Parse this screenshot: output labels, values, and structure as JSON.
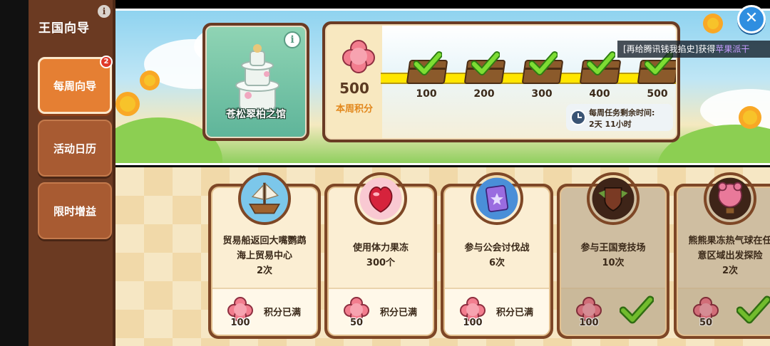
{
  "sidebar": {
    "title": "王国向导",
    "items": [
      {
        "label": "每周向导",
        "badge": "2"
      },
      {
        "label": "活动日历"
      },
      {
        "label": "限时增益"
      }
    ]
  },
  "building": {
    "name": "苍松翠柏之馆"
  },
  "weekly": {
    "points": "500",
    "points_label": "本周积分",
    "milestones": [
      "100",
      "200",
      "300",
      "400",
      "500"
    ],
    "timer_title": "每周任务剩余时间:",
    "timer_value": "2天 11小时"
  },
  "notice": {
    "prefix": "[再给腾讯钱我掐史]获得",
    "highlight": "苹果派干"
  },
  "tasks": [
    {
      "line1": "贸易船返回大嘴鹦鹉",
      "line2": "海上贸易中心",
      "count": "2次",
      "points": "100",
      "status": "积分已满"
    },
    {
      "line1": "使用体力果冻",
      "line2": "",
      "count": "300个",
      "points": "50",
      "status": "积分已满"
    },
    {
      "line1": "参与公会讨伐战",
      "line2": "",
      "count": "6次",
      "points": "100",
      "status": "积分已满"
    },
    {
      "line1": "参与王国竞技场",
      "line2": "",
      "count": "10次",
      "points": "100",
      "status": ""
    },
    {
      "line1": "熊熊果冻热气球在任",
      "line2": "意区域出发探险",
      "count": "2次",
      "points": "50",
      "status": ""
    }
  ],
  "colors": {
    "accent": "#e57f33",
    "panel": "#6b3a22",
    "close": "#2f8ee0",
    "check": "#6fcf2a"
  },
  "icons": [
    "info-icon",
    "close-icon",
    "gem-icon",
    "check-icon",
    "clock-icon",
    "ship-icon",
    "jelly-icon",
    "guild-icon",
    "arena-icon",
    "balloon-icon"
  ]
}
